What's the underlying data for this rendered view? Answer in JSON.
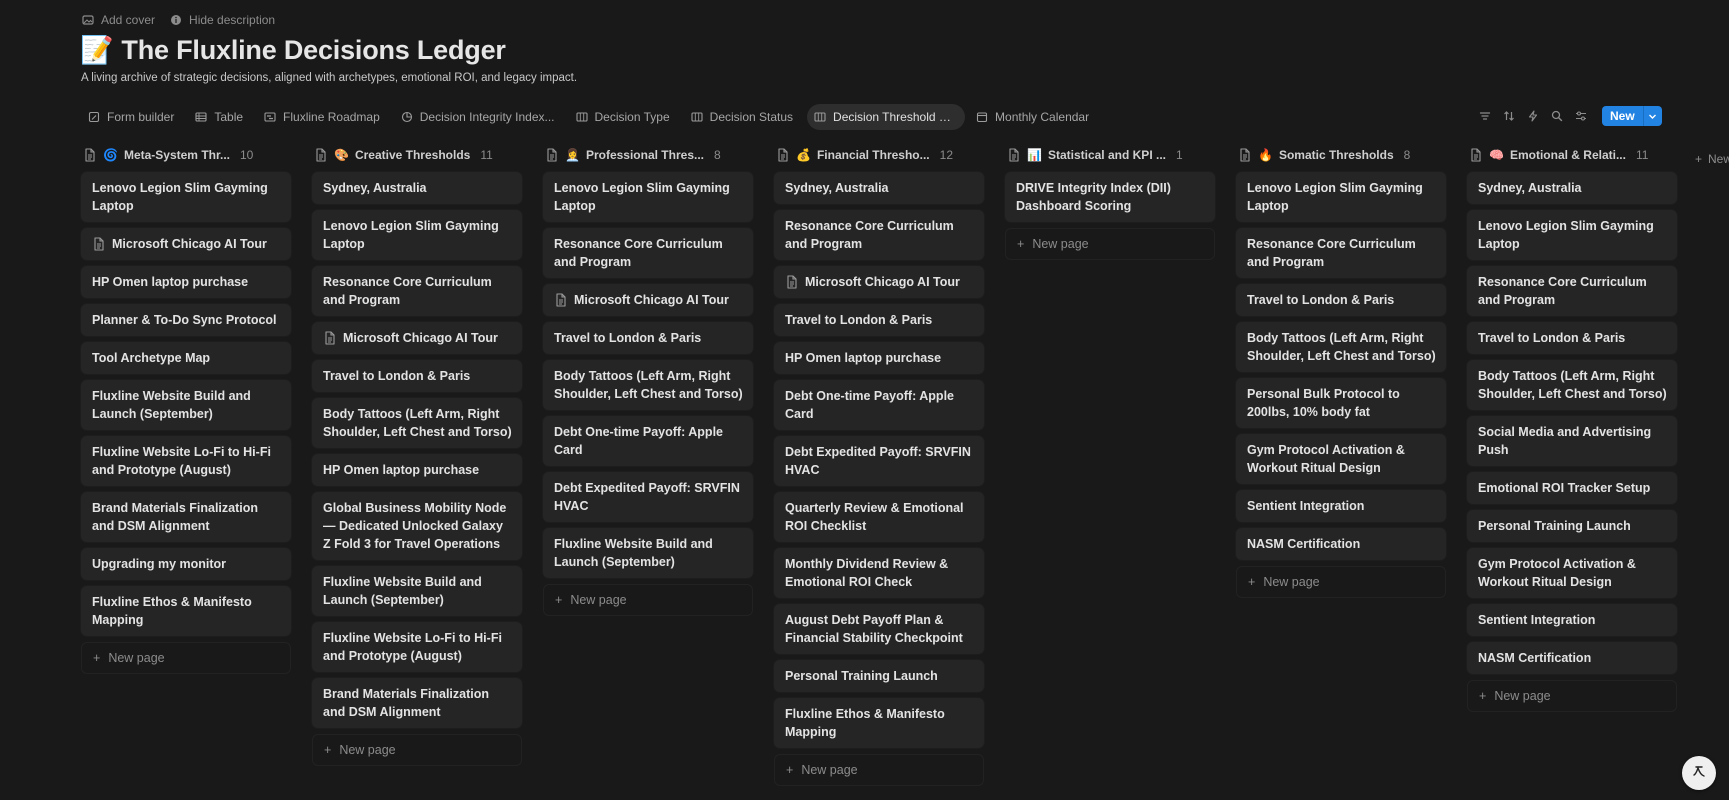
{
  "top_actions": {
    "add_cover": "Add cover",
    "hide_description": "Hide description"
  },
  "page": {
    "emoji": "📝",
    "title": "The Fluxline Decisions Ledger",
    "description": "A living archive of strategic decisions, aligned with archetypes, emotional ROI, and legacy impact."
  },
  "tabs": [
    {
      "label": "Form builder",
      "icon": "form-icon"
    },
    {
      "label": "Table",
      "icon": "table-icon"
    },
    {
      "label": "Fluxline Roadmap",
      "icon": "timeline-icon"
    },
    {
      "label": "Decision Integrity Index...",
      "icon": "chart-icon"
    },
    {
      "label": "Decision Type",
      "icon": "board-icon"
    },
    {
      "label": "Decision Status",
      "icon": "board-icon"
    },
    {
      "label": "Decision Threshold Fre...",
      "icon": "board-icon",
      "active": true
    },
    {
      "label": "Monthly Calendar",
      "icon": "calendar-icon"
    }
  ],
  "toolbar": {
    "new_label": "New"
  },
  "new_page_label": "New page",
  "add_group_label": "New",
  "columns": [
    {
      "emoji": "🌀",
      "title": "Meta-System Thr...",
      "count": "10",
      "cards": [
        {
          "title": "Lenovo Legion Slim Gayming Laptop"
        },
        {
          "title": "Microsoft Chicago AI Tour",
          "doc": true
        },
        {
          "title": "HP Omen laptop purchase"
        },
        {
          "title": "Planner & To-Do Sync Protocol"
        },
        {
          "title": "Tool Archetype Map"
        },
        {
          "title": "Fluxline Website Build and Launch (September)"
        },
        {
          "title": "Fluxline Website Lo-Fi to Hi-Fi and Prototype (August)"
        },
        {
          "title": "Brand Materials Finalization and DSM Alignment"
        },
        {
          "title": "Upgrading my monitor"
        },
        {
          "title": "Fluxline Ethos & Manifesto Mapping"
        }
      ]
    },
    {
      "emoji": "🎨",
      "title": "Creative Thresholds",
      "count": "11",
      "cards": [
        {
          "title": "Sydney, Australia"
        },
        {
          "title": "Lenovo Legion Slim Gayming Laptop"
        },
        {
          "title": "Resonance Core Curriculum and Program"
        },
        {
          "title": "Microsoft Chicago AI Tour",
          "doc": true
        },
        {
          "title": "Travel to London & Paris"
        },
        {
          "title": "Body Tattoos (Left Arm, Right Shoulder, Left Chest and Torso)"
        },
        {
          "title": "HP Omen laptop purchase"
        },
        {
          "title": "Global Business Mobility Node — Dedicated Unlocked Galaxy Z Fold 3 for Travel Operations"
        },
        {
          "title": "Fluxline Website Build and Launch (September)"
        },
        {
          "title": "Fluxline Website Lo-Fi to Hi-Fi and Prototype (August)"
        },
        {
          "title": "Brand Materials Finalization and DSM Alignment"
        }
      ]
    },
    {
      "emoji": "👩‍💼",
      "title": "Professional Thres...",
      "count": "8",
      "cards": [
        {
          "title": "Lenovo Legion Slim Gayming Laptop"
        },
        {
          "title": "Resonance Core Curriculum and Program"
        },
        {
          "title": "Microsoft Chicago AI Tour",
          "doc": true
        },
        {
          "title": "Travel to London & Paris"
        },
        {
          "title": "Body Tattoos (Left Arm, Right Shoulder, Left Chest and Torso)"
        },
        {
          "title": "Debt One-time Payoff: Apple Card"
        },
        {
          "title": "Debt Expedited Payoff: SRVFIN HVAC"
        },
        {
          "title": "Fluxline Website Build and Launch (September)"
        }
      ]
    },
    {
      "emoji": "💰",
      "title": "Financial Thresho...",
      "count": "12",
      "cards": [
        {
          "title": "Sydney, Australia"
        },
        {
          "title": "Resonance Core Curriculum and Program"
        },
        {
          "title": "Microsoft Chicago AI Tour",
          "doc": true
        },
        {
          "title": "Travel to London & Paris"
        },
        {
          "title": "HP Omen laptop purchase"
        },
        {
          "title": "Debt One-time Payoff: Apple Card"
        },
        {
          "title": "Debt Expedited Payoff: SRVFIN HVAC"
        },
        {
          "title": "Quarterly Review & Emotional ROI Checklist"
        },
        {
          "title": "Monthly Dividend Review & Emotional ROI Check"
        },
        {
          "title": "August Debt Payoff Plan & Financial Stability Checkpoint"
        },
        {
          "title": "Personal Training Launch"
        },
        {
          "title": "Fluxline Ethos & Manifesto Mapping"
        }
      ]
    },
    {
      "emoji": "📊",
      "title": "Statistical and KPI ...",
      "count": "1",
      "cards": [
        {
          "title": "DRIVE Integrity Index (DII) Dashboard Scoring"
        }
      ]
    },
    {
      "emoji": "🔥",
      "title": "Somatic Thresholds",
      "count": "8",
      "cards": [
        {
          "title": "Lenovo Legion Slim Gayming Laptop"
        },
        {
          "title": "Resonance Core Curriculum and Program"
        },
        {
          "title": "Travel to London & Paris"
        },
        {
          "title": "Body Tattoos (Left Arm, Right Shoulder, Left Chest and Torso)"
        },
        {
          "title": "Personal Bulk Protocol to 200lbs, 10% body fat"
        },
        {
          "title": "Gym Protocol Activation & Workout Ritual Design"
        },
        {
          "title": "Sentient Integration"
        },
        {
          "title": "NASM Certification"
        }
      ]
    },
    {
      "emoji": "🧠",
      "title": "Emotional & Relati...",
      "count": "11",
      "cards": [
        {
          "title": "Sydney, Australia"
        },
        {
          "title": "Lenovo Legion Slim Gayming Laptop"
        },
        {
          "title": "Resonance Core Curriculum and Program"
        },
        {
          "title": "Travel to London & Paris"
        },
        {
          "title": "Body Tattoos (Left Arm, Right Shoulder, Left Chest and Torso)"
        },
        {
          "title": "Social Media and Advertising Push"
        },
        {
          "title": "Emotional ROI Tracker Setup"
        },
        {
          "title": "Personal Training Launch"
        },
        {
          "title": "Gym Protocol Activation & Workout Ritual Design"
        },
        {
          "title": "Sentient Integration"
        },
        {
          "title": "NASM Certification"
        }
      ]
    }
  ],
  "colors": {
    "background": "#191919",
    "card": "#252525",
    "accent": "#2383e2",
    "active_tab": "#2e2e2e"
  }
}
